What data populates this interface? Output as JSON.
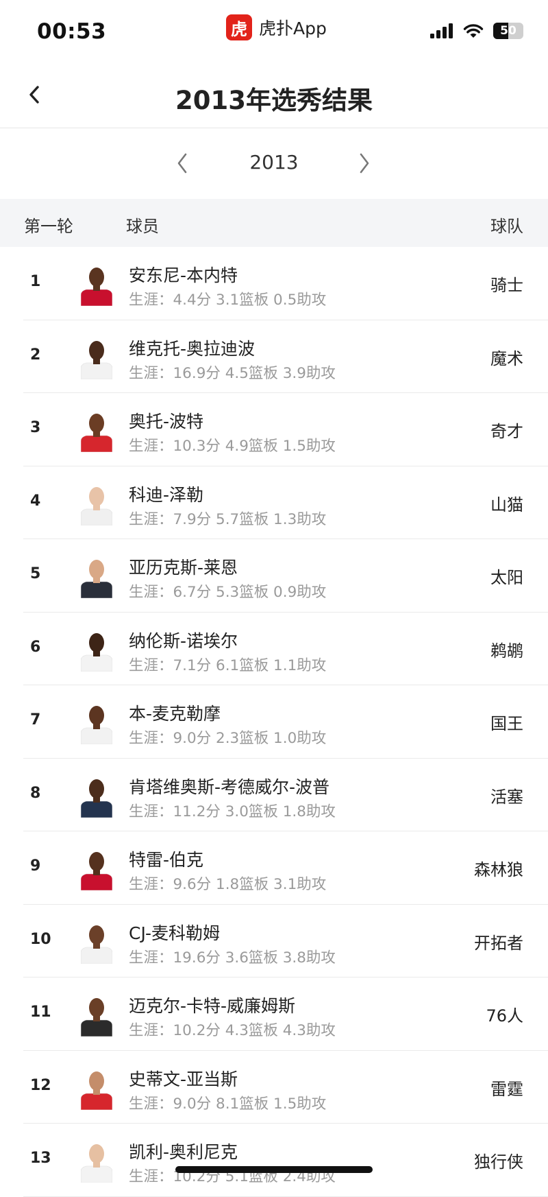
{
  "status_bar": {
    "time": "00:53",
    "app_logo_char": "虎",
    "app_name": "虎扑App",
    "battery": "50",
    "battery_level": 0.5
  },
  "header": {
    "title": "2013年选秀结果"
  },
  "year_switch": {
    "year": "2013"
  },
  "table": {
    "round_label": "第一轮",
    "player_label": "球员",
    "team_label": "球队",
    "rows": [
      {
        "pick": "1",
        "name": "安东尼-本内特",
        "stats": "生涯：4.4分 3.1篮板 0.5助攻",
        "team": "骑士",
        "jersey_color": "#c8102e",
        "skin_color": "#5a3420"
      },
      {
        "pick": "2",
        "name": "维克托-奥拉迪波",
        "stats": "生涯：16.9分 4.5篮板 3.9助攻",
        "team": "魔术",
        "jersey_color": "#f2f2f2",
        "skin_color": "#4a2c1c"
      },
      {
        "pick": "3",
        "name": "奥托-波特",
        "stats": "生涯：10.3分 4.9篮板 1.5助攻",
        "team": "奇才",
        "jersey_color": "#d6262d",
        "skin_color": "#6b3d24"
      },
      {
        "pick": "4",
        "name": "科迪-泽勒",
        "stats": "生涯：7.9分 5.7篮板 1.3助攻",
        "team": "山猫",
        "jersey_color": "#f0f0f0",
        "skin_color": "#e8c3a8"
      },
      {
        "pick": "5",
        "name": "亚历克斯-莱恩",
        "stats": "生涯：6.7分 5.3篮板 0.9助攻",
        "team": "太阳",
        "jersey_color": "#2a2f3a",
        "skin_color": "#d9a886"
      },
      {
        "pick": "6",
        "name": "纳伦斯-诺埃尔",
        "stats": "生涯：7.1分 6.1篮板 1.1助攻",
        "team": "鹈鹕",
        "jersey_color": "#f3f3f3",
        "skin_color": "#3d2416"
      },
      {
        "pick": "7",
        "name": "本-麦克勒摩",
        "stats": "生涯：9.0分 2.3篮板 1.0助攻",
        "team": "国王",
        "jersey_color": "#f2f2f2",
        "skin_color": "#5c3521"
      },
      {
        "pick": "8",
        "name": "肯塔维奥斯-考德威尔-波普",
        "stats": "生涯：11.2分 3.0篮板 1.8助攻",
        "team": "活塞",
        "jersey_color": "#24344f",
        "skin_color": "#4c2d1c"
      },
      {
        "pick": "9",
        "name": "特雷-伯克",
        "stats": "生涯：9.6分 1.8篮板 3.1助攻",
        "team": "森林狼",
        "jersey_color": "#c8102e",
        "skin_color": "#55311e"
      },
      {
        "pick": "10",
        "name": "CJ-麦科勒姆",
        "stats": "生涯：19.6分 3.6篮板 3.8助攻",
        "team": "开拓者",
        "jersey_color": "#f2f2f2",
        "skin_color": "#6b4029"
      },
      {
        "pick": "11",
        "name": "迈克尔-卡特-威廉姆斯",
        "stats": "生涯：10.2分 4.3篮板 4.3助攻",
        "team": "76人",
        "jersey_color": "#2b2b2b",
        "skin_color": "#6a3f27"
      },
      {
        "pick": "12",
        "name": "史蒂文-亚当斯",
        "stats": "生涯：9.0分 8.1篮板 1.5助攻",
        "team": "雷霆",
        "jersey_color": "#d6262d",
        "skin_color": "#c48d6a"
      },
      {
        "pick": "13",
        "name": "凯利-奥利尼克",
        "stats": "生涯：10.2分 5.1篮板 2.4助攻",
        "team": "独行侠",
        "jersey_color": "#f3f3f3",
        "skin_color": "#e6c0a2"
      }
    ]
  }
}
